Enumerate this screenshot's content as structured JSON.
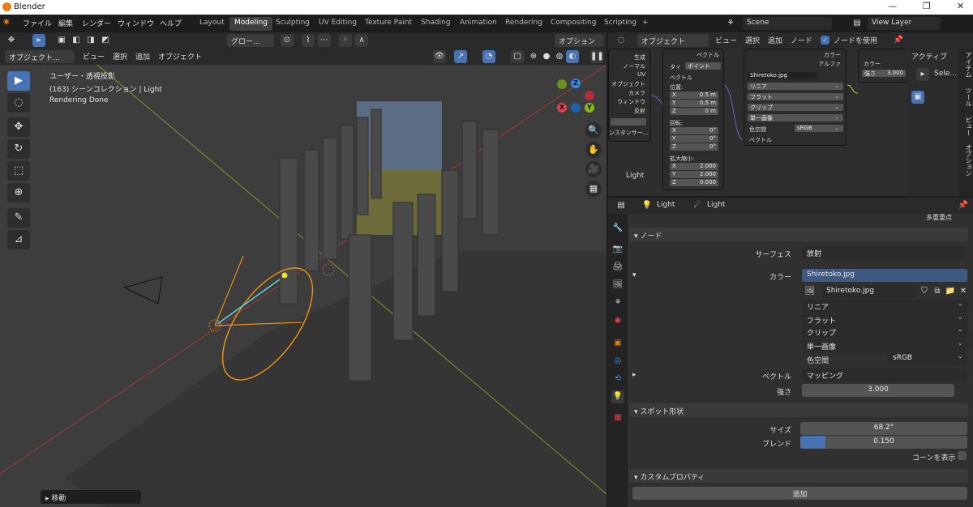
{
  "window": {
    "title": "Blender",
    "controls": [
      "—",
      "❐",
      "✕"
    ]
  },
  "menu": [
    "ファイル",
    "編集",
    "レンダー",
    "ウィンドウ",
    "ヘルプ"
  ],
  "workspaces": [
    "Layout",
    "Modeling",
    "Sculpting",
    "UV Editing",
    "Texture Paint",
    "Shading",
    "Animation",
    "Rendering",
    "Compositing",
    "Scripting",
    "+"
  ],
  "scene": "Scene",
  "view_layer": "View Layer",
  "viewport": {
    "transform_orientation": "グロー...",
    "options": "オプション",
    "mode": "オブジェクト...",
    "menu": [
      "ビュー",
      "選択",
      "追加",
      "オブジェクト"
    ],
    "overlay_lines": [
      "ユーザー・透視投影",
      "(163) シーンコレクション | Light",
      "Rendering Done"
    ],
    "last_op": "移動",
    "gizmo": {
      "x": "X",
      "y": "Y",
      "z": "Z"
    },
    "tools": [
      "▶",
      "◌",
      "✥",
      "↻",
      "⬚",
      "⊕",
      "✎",
      "⊿"
    ],
    "nav_icons": [
      "🔍",
      "✋",
      "🎥",
      "▦"
    ]
  },
  "node_editor": {
    "type": "オブジェクト",
    "menu": [
      "ビュー",
      "選択",
      "追加",
      "ノード"
    ],
    "use_nodes": "ノードを使用",
    "texcoord_outputs": [
      "生成",
      "ノーマル",
      "UV",
      "オブジェクト",
      "カメラ",
      "ウィンドウ",
      "反射"
    ],
    "instancer": "ンスタンサー...",
    "mapping": {
      "type_label": "タイ",
      "type": "ポイント",
      "vector": "ベクトル",
      "loc": "位置:",
      "rot": "回転:",
      "scale": "拡大縮小:",
      "axes": [
        "X",
        "Y",
        "Z"
      ],
      "loc_vals": [
        "0.5 m",
        "0.5 m",
        "0 m"
      ],
      "rot_vals": [
        "0°",
        "0°",
        "0°"
      ],
      "scale_vals": [
        "2.000",
        "2.000",
        "0.000"
      ],
      "out": "ベクトル"
    },
    "image": {
      "name": "Shiretoko.jpg",
      "interp": "リニア",
      "proj": "フラット",
      "ext": "クリップ",
      "source": "単一画像",
      "cs_label": "色空間",
      "cs": "sRGB",
      "vector": "ベクトル",
      "out_color": "カラー",
      "out_alpha": "アルファ"
    },
    "emission": {
      "color": "カラー",
      "strength_label": "強さ",
      "strength": "3.000",
      "out": "強"
    },
    "frame_label": "Light"
  },
  "npanel": {
    "tab": "アクティブ",
    "tool": "Sele...",
    "tabs": [
      "アイテム",
      "ツール",
      "ビュー",
      "オプション"
    ]
  },
  "properties": {
    "obj": "Light",
    "data": "Light",
    "multi": "多重重点",
    "sec_node": "ノード",
    "surface_label": "サーフェス",
    "surface": "放射",
    "color_label": "カラー",
    "color": "Shiretoko.jpg",
    "image": "Shiretoko.jpg",
    "interp": "リニア",
    "proj": "フラット",
    "ext": "クリップ",
    "source": "単一画像",
    "cs_label": "色空間",
    "cs": "sRGB",
    "vector_label": "ベクトル",
    "vector": "マッピング",
    "strength_label": "強さ",
    "strength": "3.000",
    "sec_spot": "スポット形状",
    "size_label": "サイズ",
    "size": "68.2°",
    "blend_label": "ブレンド",
    "blend": "0.150",
    "blend_frac": 0.15,
    "cone": "コーンを表示",
    "sec_custom": "カスタムプロパティ",
    "add": "追加"
  },
  "colors": {
    "accent": "#4772b3",
    "selected": "#e87d0d",
    "x": "#e04050",
    "y": "#84b51b",
    "z": "#2f87e8"
  }
}
